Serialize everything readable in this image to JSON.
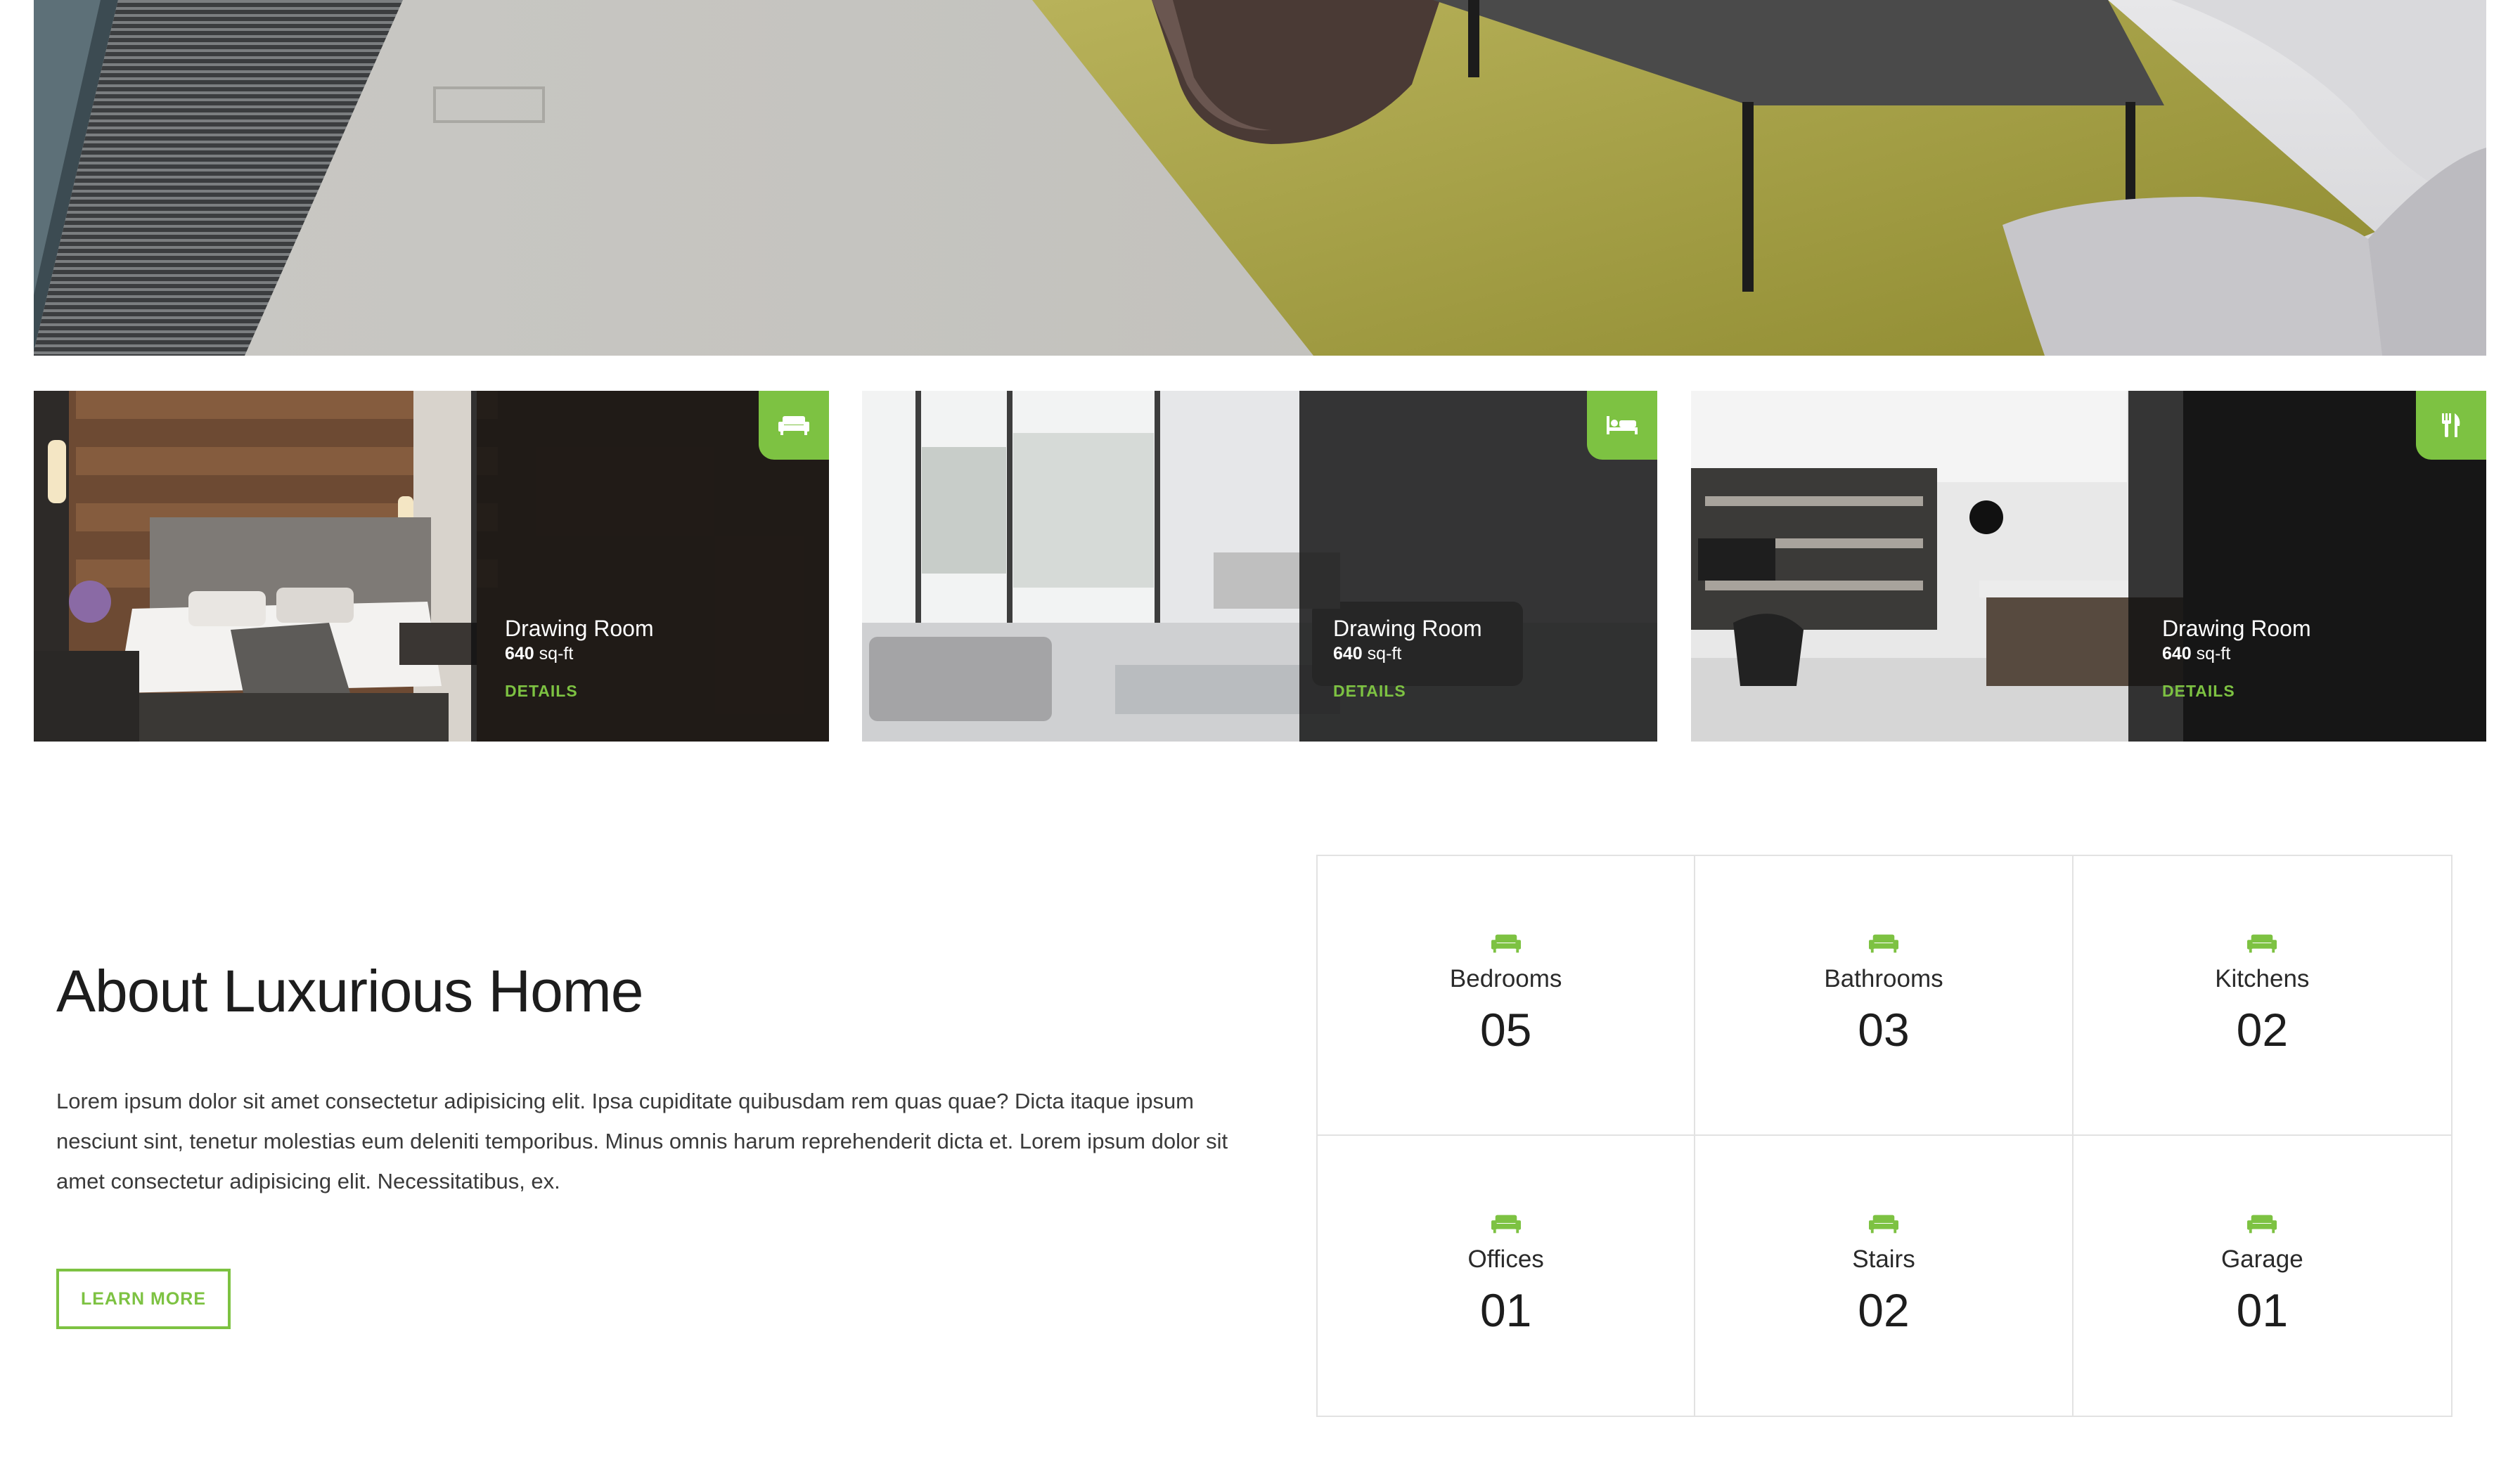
{
  "colors": {
    "accent": "#7dc242",
    "card_overlay": "#121212",
    "grid_border": "#e2e2e2"
  },
  "hero": {
    "image_desc": "living-room-photo"
  },
  "cards": [
    {
      "room_name": "Drawing Room",
      "area_value": "640",
      "area_unit": "sq-ft",
      "details_label": "DETAILS",
      "icon": "sofa-icon"
    },
    {
      "room_name": "Drawing Room",
      "area_value": "640",
      "area_unit": "sq-ft",
      "details_label": "DETAILS",
      "icon": "bed-icon"
    },
    {
      "room_name": "Drawing Room",
      "area_value": "640",
      "area_unit": "sq-ft",
      "details_label": "DETAILS",
      "icon": "cutlery-icon"
    }
  ],
  "about": {
    "title": "About Luxurious Home",
    "body": "Lorem ipsum dolor sit amet consectetur adipisicing elit. Ipsa cupiditate quibusdam rem quas quae? Dicta itaque ipsum nesciunt sint, tenetur molestias eum deleniti temporibus. Minus omnis harum reprehenderit dicta et. Lorem ipsum dolor sit amet consectetur adipisicing elit. Necessitatibus, ex.",
    "button_label": "LEARN MORE"
  },
  "stats": [
    {
      "label": "Bedrooms",
      "value": "05",
      "icon": "sofa-icon"
    },
    {
      "label": "Bathrooms",
      "value": "03",
      "icon": "sofa-icon"
    },
    {
      "label": "Kitchens",
      "value": "02",
      "icon": "sofa-icon"
    },
    {
      "label": "Offices",
      "value": "01",
      "icon": "sofa-icon"
    },
    {
      "label": "Stairs",
      "value": "02",
      "icon": "sofa-icon"
    },
    {
      "label": "Garage",
      "value": "01",
      "icon": "sofa-icon"
    }
  ]
}
